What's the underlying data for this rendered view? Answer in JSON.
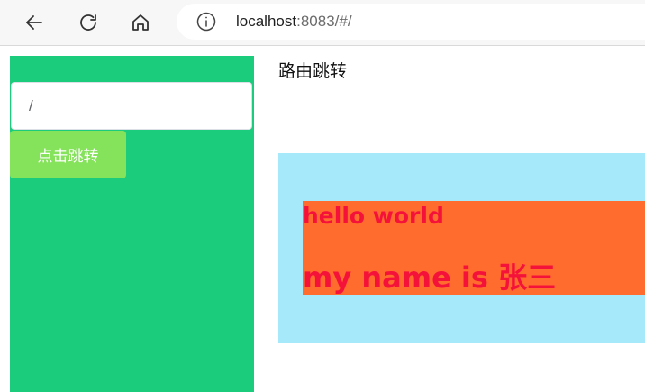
{
  "browser": {
    "url_host": "localhost",
    "url_rest": ":8083/#/",
    "icons": {
      "back": "arrow-left-icon",
      "reload": "reload-icon",
      "home": "home-icon",
      "info": "info-icon"
    }
  },
  "sidebar": {
    "background": "#1bcc7c",
    "input_value": "/",
    "button_label": "点击跳转",
    "button_color": "#85e25b"
  },
  "main": {
    "title": "路由跳转",
    "outer_color": "#a5e9fb",
    "inner_color": "#ff6c2d",
    "text_color": "#f5123a",
    "hello": "hello world",
    "name_line": "my name is 张三"
  }
}
